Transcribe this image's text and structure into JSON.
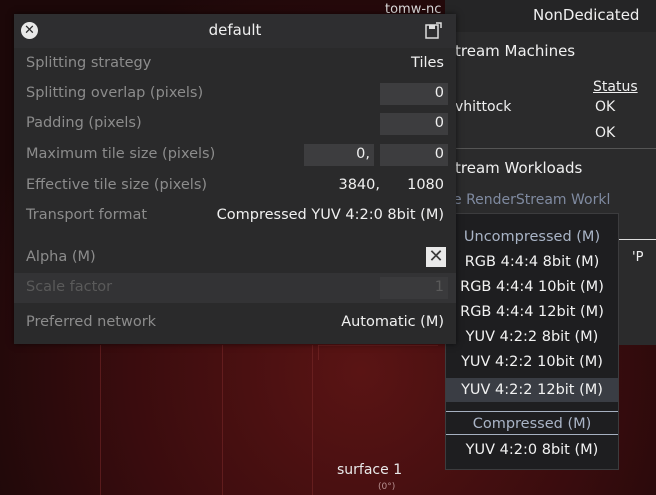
{
  "panel": {
    "title": "default",
    "close_icon": "close-icon",
    "save_icon": "save-icon"
  },
  "rows": {
    "splitting_strategy": {
      "label": "Splitting strategy",
      "value": "Tiles"
    },
    "splitting_overlap": {
      "label": "Splitting overlap (pixels)",
      "value": "0"
    },
    "padding": {
      "label": "Padding (pixels)",
      "value": "0"
    },
    "max_tile_size": {
      "label": "Maximum tile size (pixels)",
      "value_w": "0,",
      "value_h": "0"
    },
    "effective_tile_size": {
      "label": "Effective tile size (pixels)",
      "value_w": "3840,",
      "value_h": "1080"
    },
    "transport_format": {
      "label": "Transport format",
      "value": "Compressed YUV 4:2:0 8bit (M)"
    },
    "alpha": {
      "label": "Alpha (M)",
      "checked_mark": "✕"
    },
    "scale_factor": {
      "label": "Scale factor",
      "value": "1"
    },
    "preferred_network": {
      "label": "Preferred network",
      "value": "Automatic (M)"
    }
  },
  "background": {
    "top_left_text": "tomw-nc",
    "top_right_text": "NonDedicated",
    "machines_header": "tream Machines",
    "status_header": "Status",
    "machine_name": "vhittock",
    "status_1": "OK",
    "status_2": "OK",
    "workloads_header": "tream Workloads",
    "workloads_sub": "e RenderStream Workl",
    "stray_suffix": "'P",
    "surface_label": "surface 1",
    "surface_degree": "(0°)"
  },
  "format_options": {
    "uncompressed_header": "Uncompressed (M)",
    "opt_rgb444_8": "RGB 4:4:4 8bit (M)",
    "opt_rgb444_10": "RGB 4:4:4 10bit (M)",
    "opt_rgb444_12": "RGB 4:4:4 12bit (M)",
    "opt_yuv422_8": "YUV 4:2:2 8bit (M)",
    "opt_yuv422_10": "YUV 4:2:2 10bit (M)",
    "opt_yuv422_12": "YUV 4:2:2 12bit (M)",
    "compressed_header": "Compressed (M)",
    "opt_yuv420_8": "YUV 4:2:0 8bit (M)"
  }
}
